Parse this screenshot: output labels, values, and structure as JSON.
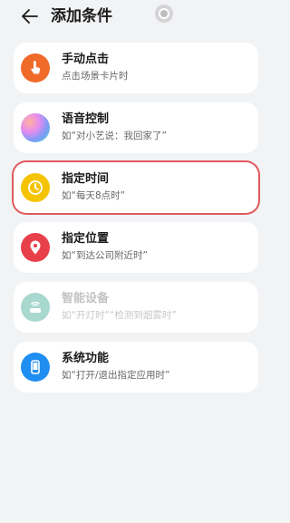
{
  "header": {
    "title": "添加条件"
  },
  "conditions": [
    {
      "name": "手动点击",
      "desc": "点击场景卡片时",
      "icon": "tap-hand-icon",
      "color": "#f06a2a",
      "enabled": true,
      "selected": false
    },
    {
      "name": "语音控制",
      "desc": "如“对小艺说：我回家了”",
      "icon": "voice-assistant-icon",
      "color": "#b06bf0",
      "enabled": true,
      "selected": false
    },
    {
      "name": "指定时间",
      "desc": "如“每天8点时”",
      "icon": "clock-icon",
      "color": "#f5c400",
      "enabled": true,
      "selected": true
    },
    {
      "name": "指定位置",
      "desc": "如“到达公司附近时”",
      "icon": "location-pin-icon",
      "color": "#e8404a",
      "enabled": true,
      "selected": false
    },
    {
      "name": "智能设备",
      "desc": "如“开灯时”“检测到烟雾时”",
      "icon": "smart-device-icon",
      "color": "#a8d8d0",
      "enabled": false,
      "selected": false
    },
    {
      "name": "系统功能",
      "desc": "如“打开/退出指定应用时”",
      "icon": "phone-icon",
      "color": "#1f8ef0",
      "enabled": true,
      "selected": false
    }
  ],
  "colors": {
    "background": "#f1f3f5",
    "selection_outline": "#e05a5e"
  }
}
